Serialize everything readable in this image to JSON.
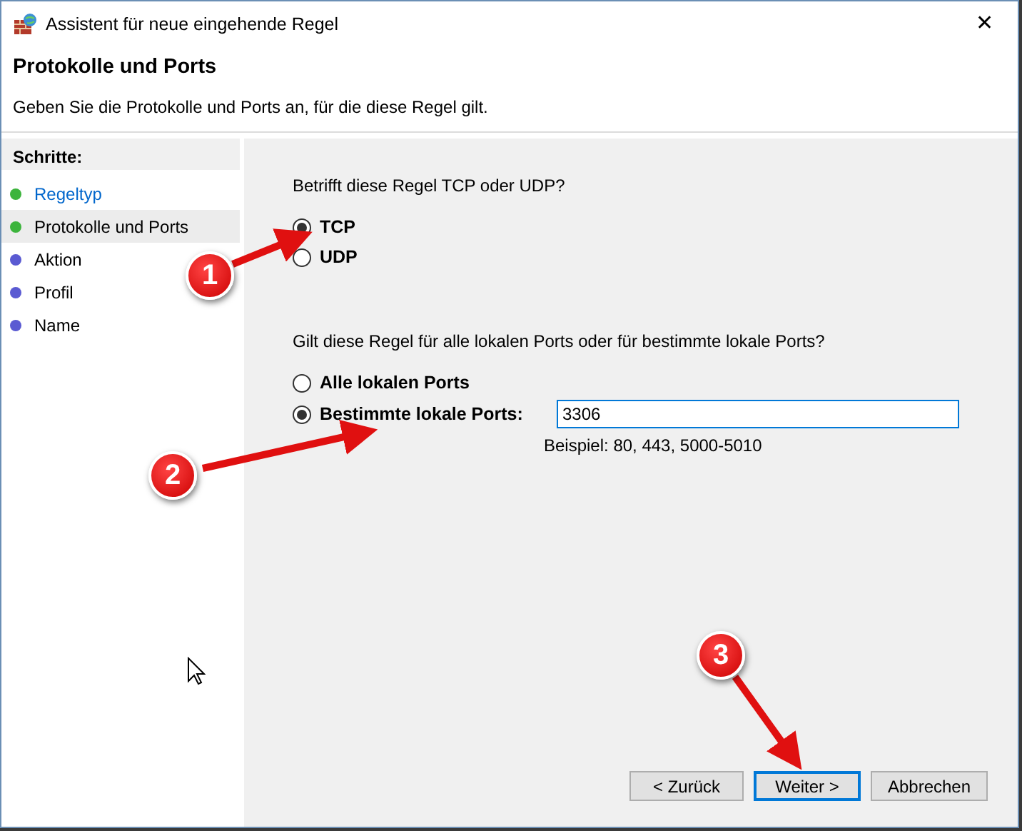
{
  "window": {
    "title": "Assistent für neue eingehende Regel",
    "close": "✕"
  },
  "header": {
    "title": "Protokolle und Ports",
    "subtitle": "Geben Sie die Protokolle und Ports an, für die diese Regel gilt."
  },
  "sidebar": {
    "heading": "Schritte:",
    "items": [
      {
        "label": "Regeltyp",
        "completed": true,
        "selected": false
      },
      {
        "label": "Protokolle und Ports",
        "completed": true,
        "selected": true
      },
      {
        "label": "Aktion",
        "completed": false,
        "selected": false
      },
      {
        "label": "Profil",
        "completed": false,
        "selected": false
      },
      {
        "label": "Name",
        "completed": false,
        "selected": false
      }
    ]
  },
  "protocol": {
    "question": "Betrifft diese Regel TCP oder UDP?",
    "options": [
      {
        "label": "TCP",
        "selected": true
      },
      {
        "label": "UDP",
        "selected": false
      }
    ]
  },
  "ports": {
    "question": "Gilt diese Regel für alle lokalen Ports oder für bestimmte lokale Ports?",
    "options": [
      {
        "label": "Alle lokalen Ports",
        "selected": false
      },
      {
        "label": "Bestimmte lokale Ports:",
        "selected": true
      }
    ],
    "value": "3306",
    "example": "Beispiel: 80, 443, 5000-5010"
  },
  "buttons": [
    {
      "label": "< Zurück",
      "default": false
    },
    {
      "label": "Weiter >",
      "default": true
    },
    {
      "label": "Abbrechen",
      "default": false
    }
  ],
  "annotations": [
    {
      "number": "1"
    },
    {
      "number": "2"
    },
    {
      "number": "3"
    }
  ]
}
